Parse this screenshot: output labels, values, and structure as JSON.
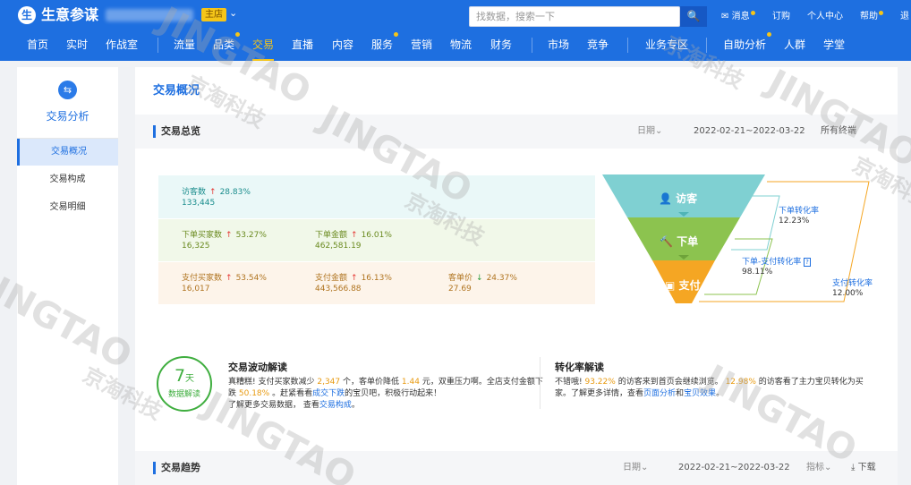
{
  "header": {
    "logo_glyph": "生",
    "brand": "生意参谋",
    "shop_badge": "主店",
    "shop_chevron": "⌄",
    "search_placeholder": "找数据，搜索一下",
    "search_icon": "🔍",
    "links": [
      "消息",
      "订购",
      "个人中心",
      "帮助",
      "退"
    ]
  },
  "nav": [
    "首页",
    "实时",
    "作战室",
    "流量",
    "品类",
    "交易",
    "直播",
    "内容",
    "服务",
    "营销",
    "物流",
    "财务",
    "市场",
    "竞争",
    "业务专区",
    "自助分析",
    "人群",
    "学堂"
  ],
  "nav_active": "交易",
  "sidebar": {
    "icon": "⇆",
    "title": "交易分析",
    "items": [
      "交易概况",
      "交易构成",
      "交易明细"
    ],
    "active_item": "交易概况"
  },
  "page_title": "交易概况",
  "overview": {
    "title": "交易总览",
    "date_label": "日期⌄",
    "date_range": "2022-02-21~2022-03-22",
    "terminal": "所有终端"
  },
  "metrics": {
    "row1": [
      {
        "label": "访客数",
        "dir": "↑",
        "pct": "28.83%",
        "value": "133,445"
      }
    ],
    "row2": [
      {
        "label": "下单买家数",
        "dir": "↑",
        "pct": "53.27%",
        "value": "16,325"
      },
      {
        "label": "下单金额",
        "dir": "↑",
        "pct": "16.01%",
        "value": "462,581.19"
      }
    ],
    "row3": [
      {
        "label": "支付买家数",
        "dir": "↑",
        "pct": "53.54%",
        "value": "16,017"
      },
      {
        "label": "支付金额",
        "dir": "↑",
        "pct": "16.13%",
        "value": "443,566.88"
      },
      {
        "label": "客单价",
        "dir": "↓",
        "pct": "24.37%",
        "value": "27.69"
      }
    ]
  },
  "funnel": {
    "visit": "访客",
    "order": "下单",
    "pay": "支付",
    "visit_icon": "👤",
    "order_icon": "🔨",
    "pay_icon": "▣",
    "rate1_label": "下单转化率",
    "rate1_value": "12.23%",
    "rate2_label": "下单-支付转化率",
    "rate2_help": "?",
    "rate2_value": "98.11%",
    "rate3_label": "支付转化率",
    "rate3_value": "12.00%"
  },
  "badge7": {
    "num": "7",
    "unit": "天",
    "text": "数据解读"
  },
  "fluct": {
    "title": "交易波动解读",
    "p1a": "真糟糕! 支付买家数减少",
    "n1": "2,347",
    "p1b": "个，客单价降低",
    "n2": "1.44",
    "p1c": "元，双重压力啊。全店支付金额下",
    "p2a": "跌",
    "n3": "50.18%",
    "p2b": "。赶紧看看",
    "l1": "成交下跌",
    "p2c": "的宝贝吧，积极行动起来！",
    "p3a": "了解更多交易数据，",
    "p3b": "查看",
    "l2": "交易构成",
    "p3c": "。"
  },
  "conv": {
    "title": "转化率解读",
    "p1a": "不错哦! ",
    "n1": "93.22%",
    "p1b": "的访客来到首页会继续浏览。",
    "n2": "12.98%",
    "p1c": "的访客看了主力宝贝转化为买",
    "p2a": "家。了解更多详情，查看",
    "l1": "页面分析",
    "p2b": "和",
    "l2": "宝贝效果",
    "p2c": "。"
  },
  "trend": {
    "title": "交易趋势",
    "date_label": "日期⌄",
    "date_range": "2022-02-21~2022-03-22",
    "indicator": "指标⌄",
    "download": "⤓ 下载"
  },
  "watermark": {
    "latin": "JINGTAO",
    "cn": "京淘科技"
  },
  "colors": {
    "primary": "#1e6fe0",
    "accent": "#f5c518",
    "funnel_top": "#7fd0d2",
    "funnel_mid": "#8cc34f",
    "funnel_bot": "#f5a623"
  }
}
